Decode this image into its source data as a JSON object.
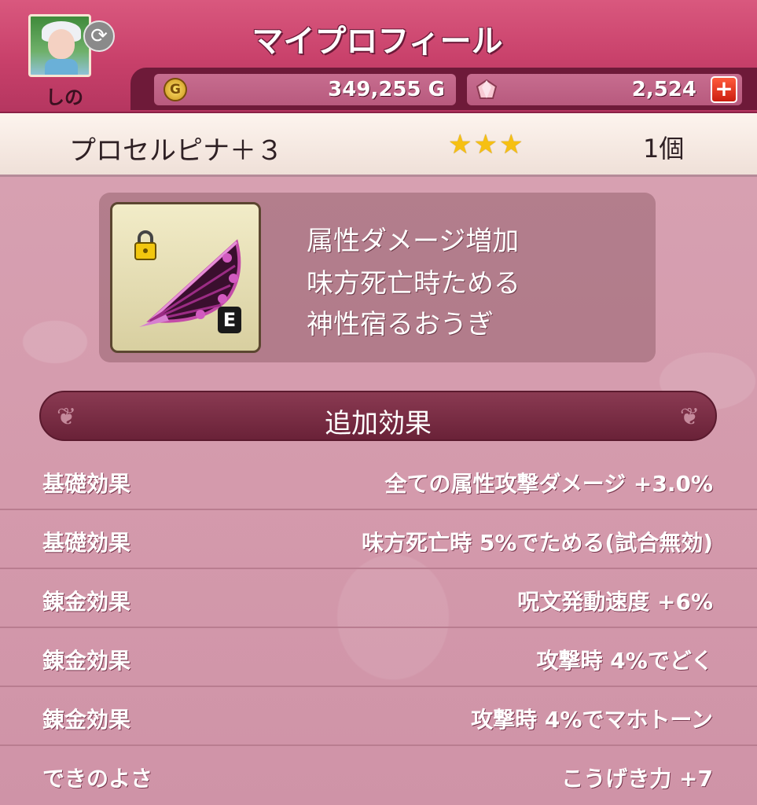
{
  "header": {
    "title": "マイプロフィール",
    "player_name": "しの",
    "gold": "349,255 G",
    "gold_icon_letter": "G",
    "gems": "2,524",
    "plus_label": "+"
  },
  "item": {
    "name": "プロセルピナ＋３",
    "stars": "★★★",
    "star_count": 3,
    "count": "1個",
    "equip_badge": "E",
    "description": [
      "属性ダメージ増加",
      "味方死亡時ためる",
      "神性宿るおうぎ"
    ]
  },
  "section": {
    "title": "追加効果"
  },
  "effects": [
    {
      "label": "基礎効果",
      "value": "全ての属性攻撃ダメージ +3.0%"
    },
    {
      "label": "基礎効果",
      "value": "味方死亡時 5%でためる(試合無効)"
    },
    {
      "label": "錬金効果",
      "value": "呪文発動速度 +6%"
    },
    {
      "label": "錬金効果",
      "value": "攻撃時 4%でどく"
    },
    {
      "label": "錬金効果",
      "value": "攻撃時 4%でマホトーン"
    },
    {
      "label": "できのよさ",
      "value": "こうげき力 +7"
    }
  ],
  "colors": {
    "header": "#c8406a",
    "content": "#d7a0b1",
    "star": "#f6c012",
    "plus": "#cc1e10"
  }
}
